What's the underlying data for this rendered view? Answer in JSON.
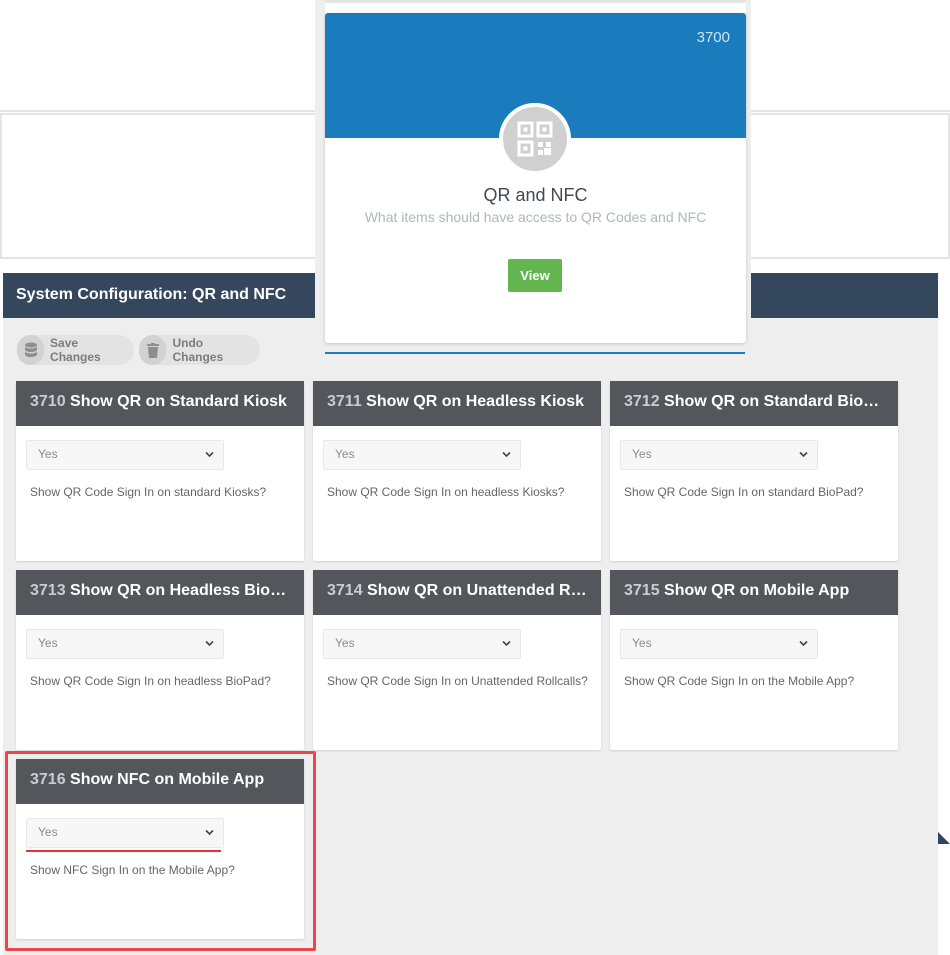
{
  "popup": {
    "number": "3700",
    "title": "QR and NFC",
    "subtitle": "What items should have access to QR Codes and NFC",
    "view_label": "View"
  },
  "system": {
    "title": "System Configuration: QR and NFC"
  },
  "toolbar": {
    "save_label": "Save Changes",
    "undo_label": "Undo Changes"
  },
  "settings": [
    {
      "number": "3710",
      "title": "Show QR on Standard Kiosk",
      "value": "Yes",
      "description": "Show QR Code Sign In on standard Kiosks?"
    },
    {
      "number": "3711",
      "title": "Show QR on Headless Kiosk",
      "value": "Yes",
      "description": "Show QR Code Sign In on headless Kiosks?"
    },
    {
      "number": "3712",
      "title": "Show QR on Standard BioPad",
      "value": "Yes",
      "description": "Show QR Code Sign In on standard BioPad?"
    },
    {
      "number": "3713",
      "title": "Show QR on Headless BioPad",
      "value": "Yes",
      "description": "Show QR Code Sign In on headless BioPad?"
    },
    {
      "number": "3714",
      "title": "Show QR on Unattended Rol...",
      "value": "Yes",
      "description": "Show QR Code Sign In on Unattended Rollcalls?"
    },
    {
      "number": "3715",
      "title": "Show QR on Mobile App",
      "value": "Yes",
      "description": "Show QR Code Sign In on the Mobile App?"
    },
    {
      "number": "3716",
      "title": "Show NFC on Mobile App",
      "value": "Yes",
      "description": "Show NFC Sign In on the Mobile App?"
    }
  ],
  "colors": {
    "header_bg": "#34475d",
    "card_header_bg": "#53575b",
    "banner_blue": "#1a7cbd",
    "view_green": "#62b54f",
    "highlight_red": "#e8474b"
  }
}
